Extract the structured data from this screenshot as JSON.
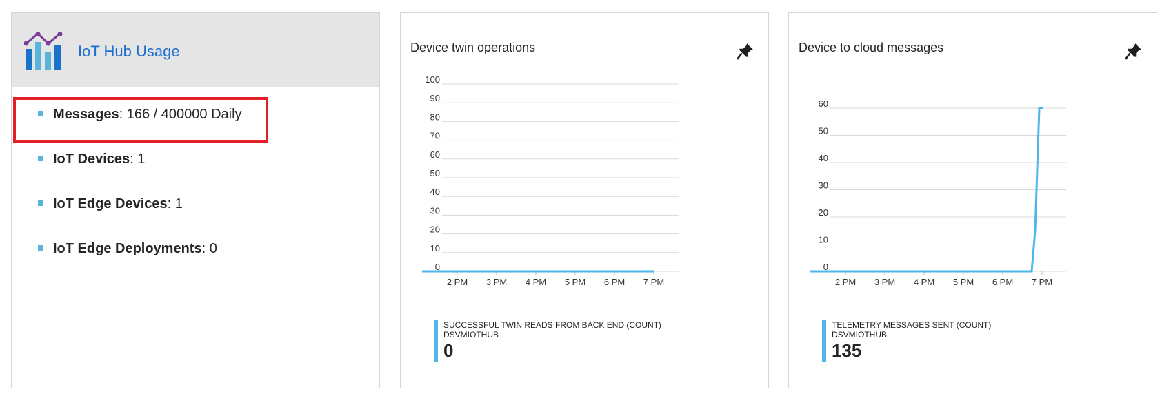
{
  "usage": {
    "title": "IoT Hub Usage",
    "items": [
      {
        "label": "Messages",
        "value": ": 166 / 400000 Daily"
      },
      {
        "label": "IoT Devices",
        "value": ": 1"
      },
      {
        "label": "IoT Edge Devices",
        "value": ": 1"
      },
      {
        "label": "IoT Edge Deployments",
        "value": ": 0"
      }
    ]
  },
  "twin": {
    "title": "Device twin operations",
    "metric_name": "SUCCESSFUL TWIN READS FROM BACK END (COUNT)",
    "resource": "DSVMIOTHUB",
    "value": "0"
  },
  "d2c": {
    "title": "Device to cloud messages",
    "metric_name": "TELEMETRY MESSAGES SENT (COUNT)",
    "resource": "DSVMIOTHUB",
    "value": "135"
  },
  "colors": {
    "accent": "#1d6ed0",
    "line": "#4fb6ea",
    "highlight": "#e3202a"
  },
  "chart_data": [
    {
      "type": "line",
      "title": "Device twin operations",
      "x": [
        "2 PM",
        "3 PM",
        "4 PM",
        "5 PM",
        "6 PM",
        "7 PM"
      ],
      "yticks": [
        "0",
        "10",
        "20",
        "30",
        "40",
        "50",
        "60",
        "70",
        "80",
        "90",
        "100"
      ],
      "ylim": [
        0,
        100
      ],
      "grid": true,
      "series": [
        {
          "name": "SUCCESSFUL TWIN READS FROM BACK END (COUNT)",
          "values": [
            0,
            0,
            0,
            0,
            0,
            0,
            0
          ]
        }
      ]
    },
    {
      "type": "line",
      "title": "Device to cloud messages",
      "x": [
        "2 PM",
        "3 PM",
        "4 PM",
        "5 PM",
        "6 PM",
        "7 PM"
      ],
      "yticks": [
        "0",
        "10",
        "20",
        "30",
        "40",
        "50",
        "60"
      ],
      "ylim": [
        0,
        60
      ],
      "grid": true,
      "series": [
        {
          "name": "TELEMETRY MESSAGES SENT (COUNT)",
          "values": [
            0,
            0,
            0,
            0,
            0,
            0,
            0,
            15,
            60,
            60
          ]
        }
      ]
    }
  ]
}
